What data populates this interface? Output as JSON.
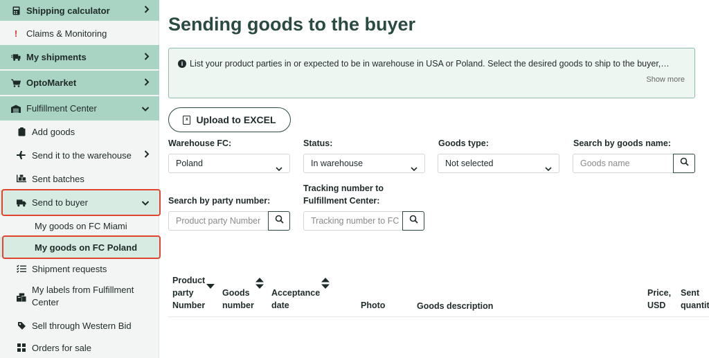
{
  "sidebar": {
    "items": [
      {
        "label": "Shipping calculator",
        "icon": "calculator-icon"
      },
      {
        "label": "Claims & Monitoring",
        "icon": "exclamation-icon"
      },
      {
        "label": "My shipments",
        "icon": "shipments-icon"
      },
      {
        "label": "OptoMarket",
        "icon": "cart-icon"
      },
      {
        "label": "Fulfillment Center",
        "icon": "warehouse-icon"
      },
      {
        "label": "Add goods",
        "icon": "clipboard-icon"
      },
      {
        "label": "Send it to the warehouse",
        "icon": "plane-icon"
      },
      {
        "label": "Sent batches",
        "icon": "boxes-icon"
      },
      {
        "label": "Send to buyer",
        "icon": "truck-icon"
      },
      {
        "label": "My goods on FC Miami"
      },
      {
        "label": "My goods on FC Poland"
      },
      {
        "label": "Shipment requests",
        "icon": "list-icon"
      },
      {
        "label": "My labels from Fulfillment",
        "label2": "Center",
        "icon": "labels-icon"
      },
      {
        "label": "Sell through Western Bid",
        "icon": "sell-icon"
      },
      {
        "label": "Orders for sale",
        "icon": "orders-icon"
      }
    ]
  },
  "main": {
    "title": "Sending goods to the buyer",
    "info": {
      "text": "List your product parties in or expected to be in warehouse in USA or Poland. Select the desired goods to ship to the buyer,…",
      "show_more": "Show more"
    },
    "upload_label": "Upload to EXCEL",
    "filters": {
      "warehouse": {
        "label": "Warehouse FC:",
        "value": "Poland"
      },
      "status": {
        "label": "Status:",
        "value": "In warehouse"
      },
      "goods_type": {
        "label": "Goods type:",
        "value": "Not selected"
      },
      "goods_name": {
        "label": "Search by goods name:",
        "placeholder": "Goods name"
      },
      "party_number": {
        "label": "Search by party number:",
        "placeholder": "Product party Number"
      },
      "tracking": {
        "label_line1": "Tracking number to",
        "label_line2": "Fulfillment Center:",
        "placeholder": "Tracking number to FC"
      }
    },
    "table": {
      "headers": {
        "party": [
          "Product",
          "party",
          "Number"
        ],
        "goods_number": [
          "Goods",
          "number"
        ],
        "acceptance": [
          "Acceptance",
          "date"
        ],
        "photo": "Photo",
        "description": "Goods description",
        "price": [
          "Price,",
          "USD"
        ],
        "sent": [
          "Sent",
          "quantity"
        ]
      }
    }
  }
}
